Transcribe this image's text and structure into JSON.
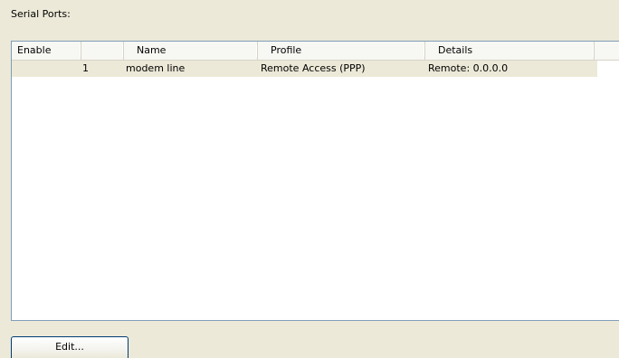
{
  "section": {
    "label": "Serial Ports:"
  },
  "table": {
    "columns": [
      "Enable",
      "",
      "Name",
      "Profile",
      "Details"
    ],
    "rows": [
      {
        "enable": "1",
        "name": "modem line",
        "profile": "Remote Access (PPP)",
        "details": "Remote: 0.0.0.0"
      }
    ]
  },
  "buttons": {
    "edit_label": "Edit..."
  },
  "colors": {
    "dialog_background": "#ece9d8",
    "list_background": "#ffffff",
    "list_border": "#7f9db9",
    "selected_row": "#ece9d8",
    "button_border": "#003c74"
  }
}
